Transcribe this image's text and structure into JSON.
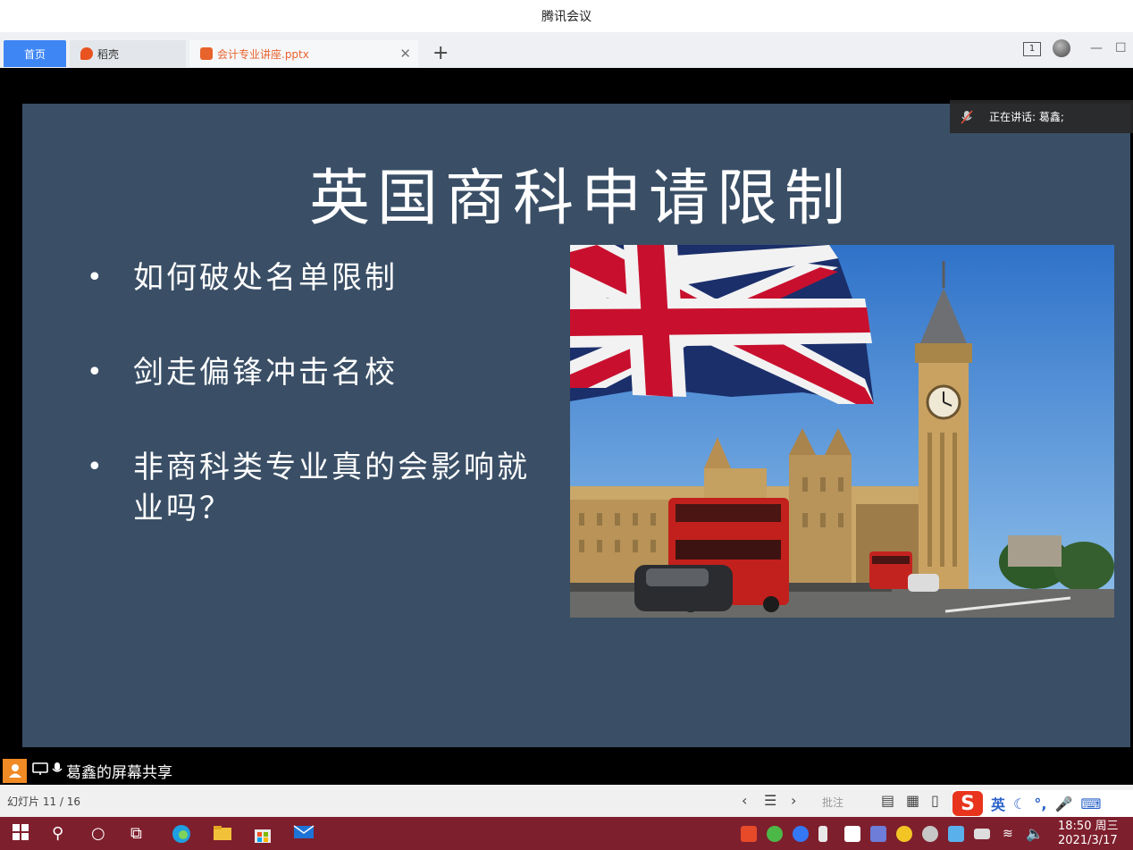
{
  "window": {
    "title": "腾讯会议"
  },
  "tabs": [
    {
      "label": "首页"
    },
    {
      "label": "稻壳"
    },
    {
      "label": "会计专业讲座.pptx"
    }
  ],
  "topbar": {
    "screen_count": "1"
  },
  "speaking": {
    "label": "正在讲话: 葛鑫;"
  },
  "slide": {
    "title": "英国商科申请限制",
    "bullets": [
      "如何破处名单限制",
      "剑走偏锋冲击名校",
      "非商科类专业真的会影响就业吗？"
    ]
  },
  "share": {
    "label": "葛鑫的屏幕共享"
  },
  "statusbar": {
    "slide_counter": "幻灯片 11 / 16",
    "notes_label": "批注"
  },
  "ime": {
    "mode": "英"
  },
  "clock": {
    "time": "18:50 周三",
    "date": "2021/3/17"
  },
  "colors": {
    "slide_bg": "#3a4f66",
    "taskbar_bg": "#7e1f2d",
    "tab_active": "#3f86f5",
    "ppt_tab_text": "#e8622c"
  }
}
